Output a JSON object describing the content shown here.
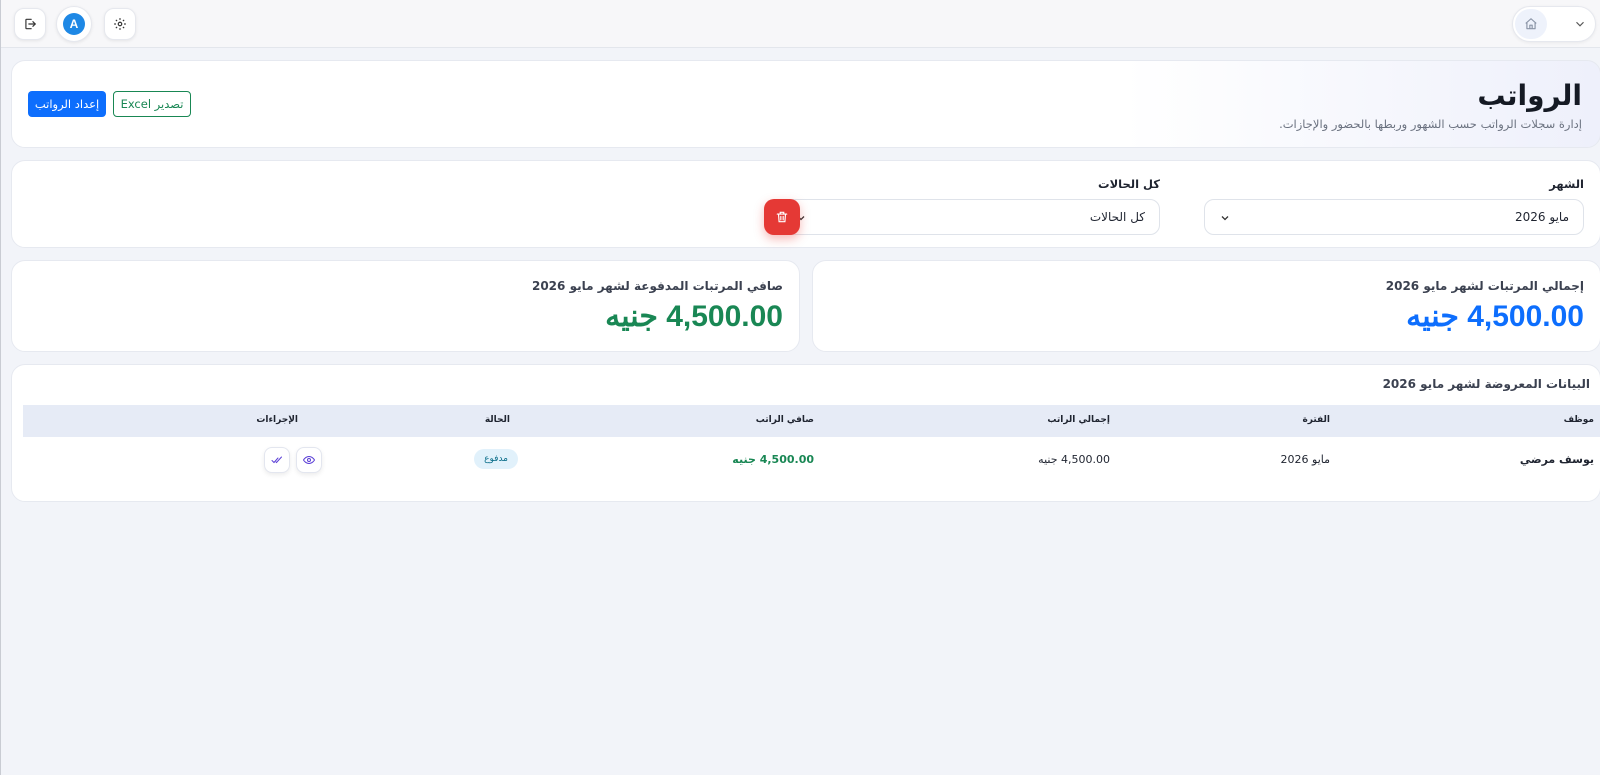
{
  "topbar": {
    "avatar_letter": "A",
    "icons": [
      "logout-icon",
      "avatar",
      "settings-icon",
      "home-icon",
      "chevron-down-icon"
    ]
  },
  "header": {
    "title": "الرواتب",
    "subtitle": "إدارة سجلات الرواتب حسب الشهور وربطها بالحضور والإجازات.",
    "prepare_button": "إعداد الرواتب",
    "export_button": "تصدير Excel"
  },
  "filters": {
    "month_label": "الشهر",
    "month_value": "مايو 2026",
    "status_label": "كل الحالات",
    "status_value": "كل الحالات"
  },
  "stats": {
    "total_label": "إجمالي المرتبات لشهر مايو 2026",
    "total_value": "4,500.00 جنيه",
    "paid_label": "صافي المرتبات المدفوعة لشهر مايو 2026",
    "paid_value": "4,500.00 جنيه"
  },
  "table": {
    "title": "البيانات المعروضة لشهر مايو 2026",
    "headers": {
      "employee": "موظف",
      "period": "الفترة",
      "gross": "إجمالي الراتب",
      "net": "صافي الراتب",
      "status": "الحالة",
      "actions": "الإجراءات"
    },
    "rows": [
      {
        "employee": "يوسف مرضي",
        "period": "مايو 2026",
        "gross": "4,500.00 جنيه",
        "net": "4,500.00 جنيه",
        "status": "مدفوع"
      }
    ]
  },
  "colors": {
    "primary": "#0d6efd",
    "success": "#198754",
    "danger": "#e53935",
    "total_value": "#0d6efd",
    "paid_value": "#198754"
  }
}
